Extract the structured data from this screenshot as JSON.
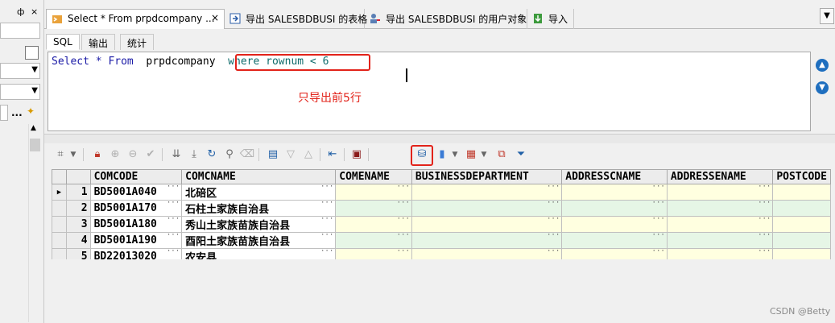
{
  "left_panel": {
    "pin_glyph": "ф",
    "close_glyph": "×",
    "ellipsis": "..."
  },
  "tabs": [
    {
      "label": "Select * From prpdcompany ...",
      "icon": "sql-window-icon",
      "closable": true
    },
    {
      "label": "导出 SALESBDBUSI 的表格",
      "icon": "export-table-icon"
    },
    {
      "label": "导出 SALESBDBUSI 的用户对象",
      "icon": "export-user-objects-icon"
    },
    {
      "label": "导入",
      "icon": "import-icon"
    }
  ],
  "subtabs": [
    "SQL",
    "输出",
    "统计"
  ],
  "sql": {
    "kw_select": "Select",
    "star": "*",
    "kw_from": "From",
    "table": "prpdcompany",
    "where_clause": "where rownum < 6"
  },
  "annotation": "只导出前5行",
  "grid": {
    "columns": [
      "COMCODE",
      "COMCNAME",
      "COMENAME",
      "BUSINESSDEPARTMENT",
      "ADDRESSCNAME",
      "ADDRESSENAME",
      "POSTCODE"
    ],
    "rows": [
      {
        "n": "1",
        "comcode": "BD5001A040",
        "comcname": "北碚区",
        "current": true
      },
      {
        "n": "2",
        "comcode": "BD5001A170",
        "comcname": "石柱土家族自治县"
      },
      {
        "n": "3",
        "comcode": "BD5001A180",
        "comcname": "秀山土家族苗族自治县"
      },
      {
        "n": "4",
        "comcode": "BD5001A190",
        "comcname": "酉阳土家族苗族自治县"
      },
      {
        "n": "5",
        "comcode": "BD22013020",
        "comcname": "农安县"
      }
    ]
  },
  "watermark": "CSDN @Betty",
  "colors": {
    "highlight": "#e2231a",
    "editable_cell": "#ffffe0",
    "alt_row": "#e6f6e6"
  }
}
